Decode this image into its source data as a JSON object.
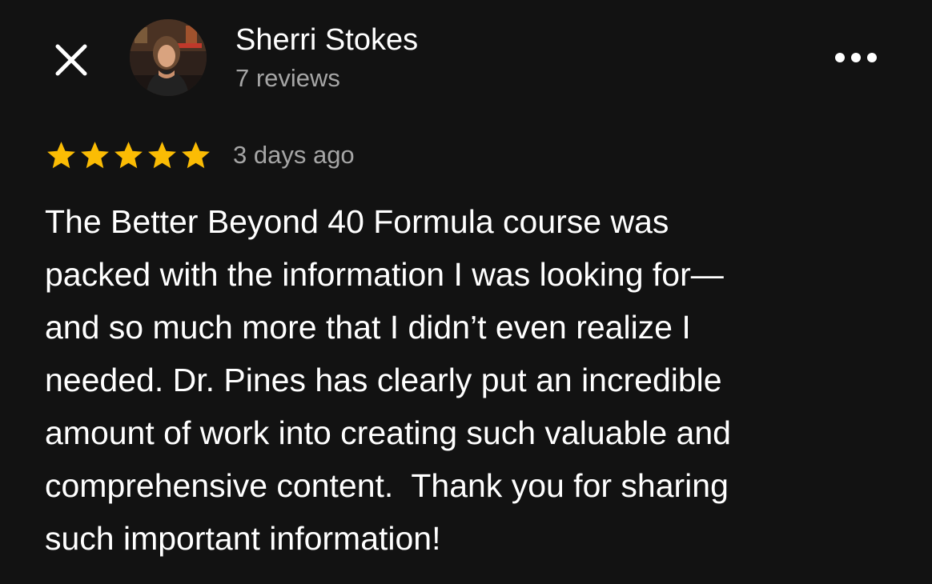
{
  "header": {
    "close_icon": "close-icon",
    "more_icon": "more-horizontal-icon",
    "avatar_icon": "profile-photo"
  },
  "reviewer": {
    "name": "Sherri Stokes",
    "review_count": "7 reviews"
  },
  "review": {
    "rating": 5,
    "rating_max": 5,
    "star_color": "#fbbc04",
    "date": "3 days ago",
    "lines": [
      "The Better Beyond 40 Formula course was",
      "packed with the information I was looking for—",
      "and so much more that I didn’t even realize I",
      "needed. Dr. Pines has clearly put an incredible",
      "amount of work into creating such valuable and",
      "comprehensive content.  Thank you for sharing",
      "such important information!"
    ]
  },
  "colors": {
    "background": "#121212",
    "primary_text": "#ffffff",
    "secondary_text": "#a6a6a6"
  }
}
